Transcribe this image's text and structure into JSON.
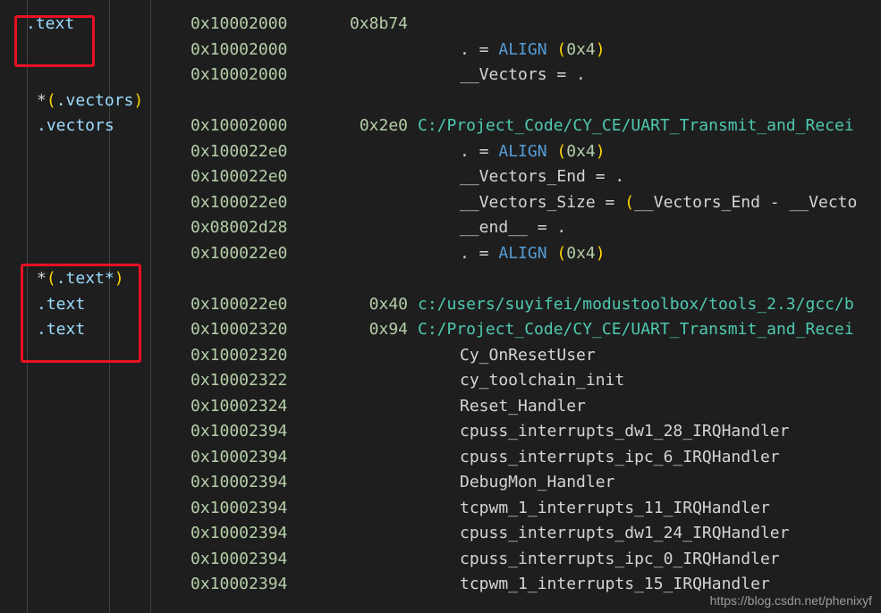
{
  "rows": [
    {
      "section": ".text",
      "address": "0x10002000",
      "size": "0x8b74",
      "path": "",
      "expr": []
    },
    {
      "section": "",
      "address": "0x10002000",
      "size": "",
      "path": "",
      "expr": [
        {
          "t": ". = ",
          "c": "sym"
        },
        {
          "t": "ALIGN",
          "c": "kw"
        },
        {
          "t": " ",
          "c": "sym"
        },
        {
          "t": "(",
          "c": "par"
        },
        {
          "t": "0x4",
          "c": "num"
        },
        {
          "t": ")",
          "c": "par"
        }
      ]
    },
    {
      "section": "",
      "address": "0x10002000",
      "size": "",
      "path": "",
      "expr": [
        {
          "t": "__Vectors = .",
          "c": "sym"
        }
      ]
    },
    {
      "section": "*(.vectors)",
      "address": "",
      "size": "",
      "path": "",
      "expr": []
    },
    {
      "section": ".vectors",
      "address": "0x10002000",
      "size": "0x2e0",
      "path": "C:/Project_Code/CY_CE/UART_Transmit_and_Recei",
      "expr": []
    },
    {
      "section": "",
      "address": "0x100022e0",
      "size": "",
      "path": "",
      "expr": [
        {
          "t": ". = ",
          "c": "sym"
        },
        {
          "t": "ALIGN",
          "c": "kw"
        },
        {
          "t": " ",
          "c": "sym"
        },
        {
          "t": "(",
          "c": "par"
        },
        {
          "t": "0x4",
          "c": "num"
        },
        {
          "t": ")",
          "c": "par"
        }
      ]
    },
    {
      "section": "",
      "address": "0x100022e0",
      "size": "",
      "path": "",
      "expr": [
        {
          "t": "__Vectors_End = .",
          "c": "sym"
        }
      ]
    },
    {
      "section": "",
      "address": "0x100022e0",
      "size": "",
      "path": "",
      "expr": [
        {
          "t": "__Vectors_Size = ",
          "c": "sym"
        },
        {
          "t": "(",
          "c": "par"
        },
        {
          "t": "__Vectors_End - __Vecto",
          "c": "sym"
        }
      ]
    },
    {
      "section": "",
      "address": "0x08002d28",
      "size": "",
      "path": "",
      "expr": [
        {
          "t": "__end__ = .",
          "c": "sym"
        }
      ]
    },
    {
      "section": "",
      "address": "0x100022e0",
      "size": "",
      "path": "",
      "expr": [
        {
          "t": ". = ",
          "c": "sym"
        },
        {
          "t": "ALIGN",
          "c": "kw"
        },
        {
          "t": " ",
          "c": "sym"
        },
        {
          "t": "(",
          "c": "par"
        },
        {
          "t": "0x4",
          "c": "num"
        },
        {
          "t": ")",
          "c": "par"
        }
      ]
    },
    {
      "section": "*(.text*)",
      "address": "",
      "size": "",
      "path": "",
      "expr": []
    },
    {
      "section": ".text",
      "address": "0x100022e0",
      "size": "0x40",
      "path": "c:/users/suyifei/modustoolbox/tools_2.3/gcc/b",
      "expr": []
    },
    {
      "section": ".text",
      "address": "0x10002320",
      "size": "0x94",
      "path": "C:/Project_Code/CY_CE/UART_Transmit_and_Recei",
      "expr": []
    },
    {
      "section": "",
      "address": "0x10002320",
      "size": "",
      "path": "",
      "symbol": "Cy_OnResetUser",
      "expr": []
    },
    {
      "section": "",
      "address": "0x10002322",
      "size": "",
      "path": "",
      "symbol": "cy_toolchain_init",
      "expr": []
    },
    {
      "section": "",
      "address": "0x10002324",
      "size": "",
      "path": "",
      "symbol": "Reset_Handler",
      "expr": []
    },
    {
      "section": "",
      "address": "0x10002394",
      "size": "",
      "path": "",
      "symbol": "cpuss_interrupts_dw1_28_IRQHandler",
      "expr": []
    },
    {
      "section": "",
      "address": "0x10002394",
      "size": "",
      "path": "",
      "symbol": "cpuss_interrupts_ipc_6_IRQHandler",
      "expr": []
    },
    {
      "section": "",
      "address": "0x10002394",
      "size": "",
      "path": "",
      "symbol": "DebugMon_Handler",
      "expr": []
    },
    {
      "section": "",
      "address": "0x10002394",
      "size": "",
      "path": "",
      "symbol": "tcpwm_1_interrupts_11_IRQHandler",
      "expr": []
    },
    {
      "section": "",
      "address": "0x10002394",
      "size": "",
      "path": "",
      "symbol": "cpuss_interrupts_dw1_24_IRQHandler",
      "expr": []
    },
    {
      "section": "",
      "address": "0x10002394",
      "size": "",
      "path": "",
      "symbol": "cpuss_interrupts_ipc_0_IRQHandler",
      "expr": []
    },
    {
      "section": "",
      "address": "0x10002394",
      "size": "",
      "path": "",
      "symbol": "tcpwm_1_interrupts_15_IRQHandler",
      "expr": []
    }
  ],
  "watermark": "https://blog.csdn.net/phenixyf",
  "colors": {
    "background": "#1e1e1e",
    "section": "#9cdcfe",
    "address": "#b5cea8",
    "path": "#4ec9b0",
    "keyword": "#569cd6",
    "paren": "#ffd700",
    "highlight_box": "#e81123"
  }
}
